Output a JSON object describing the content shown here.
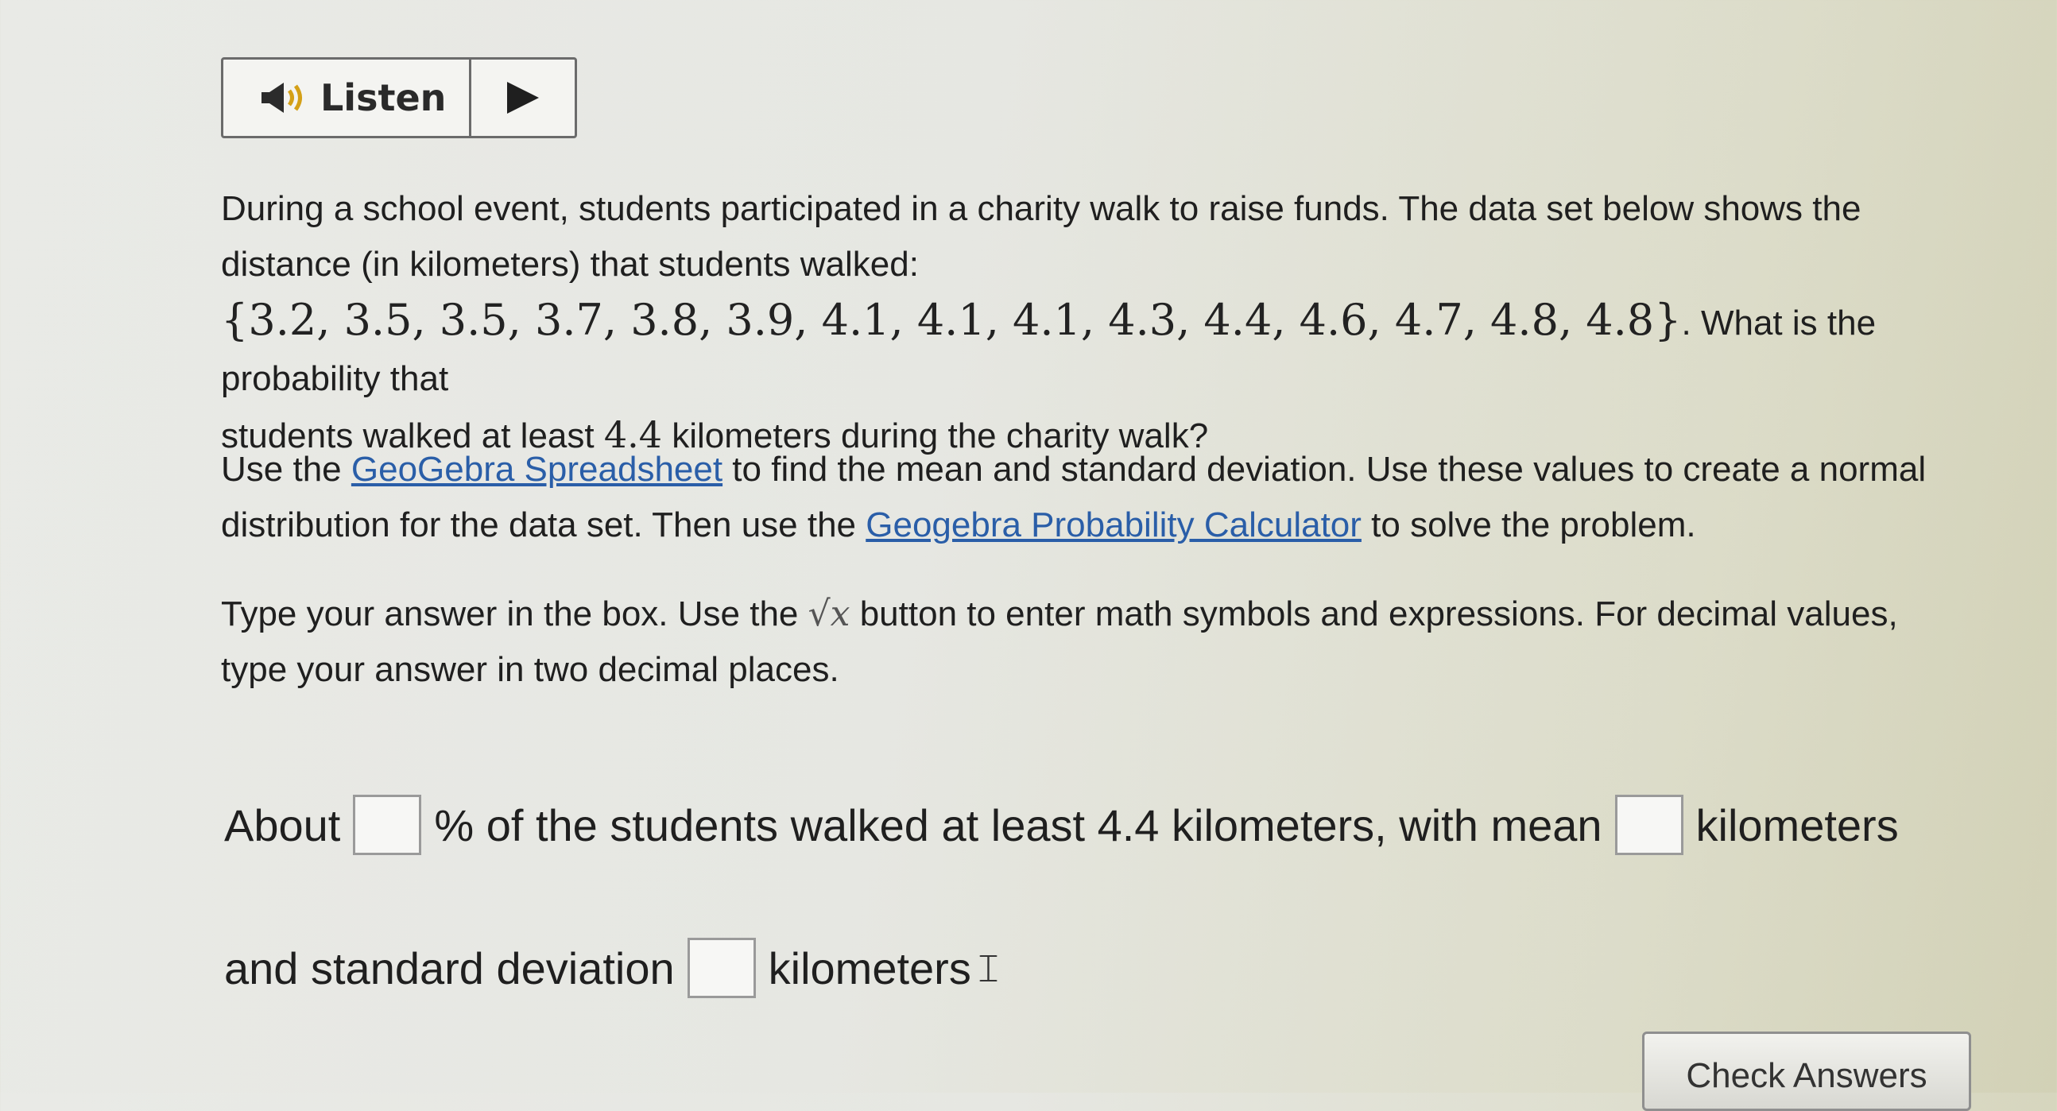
{
  "listen": {
    "label": "Listen",
    "speaker_icon": "speaker-icon",
    "play_icon": "play-icon"
  },
  "question": {
    "line1": "During a school event, students participated in a charity walk to raise funds. The data set below shows the",
    "line2": "distance (in kilometers) that students walked:",
    "dataset": "{3.2, 3.5, 3.5, 3.7, 3.8, 3.9, 4.1, 4.1, 4.1, 4.3, 4.4, 4.6, 4.7, 4.8, 4.8}",
    "line3_after": ". What is the probability that",
    "line4_before": "students walked at least ",
    "threshold": "4.4",
    "line4_after": " kilometers during the charity walk?"
  },
  "instructions": {
    "p1_before": "Use the ",
    "link1": "GeoGebra Spreadsheet",
    "p1_middle": " to find the mean and standard deviation. Use these values to create a normal distribution for the data set. Then use the ",
    "link2": "Geogebra Probability Calculator",
    "p1_after": " to solve the problem.",
    "p2_before": "Type your answer in the box. Use the ",
    "sqrt_symbol": "√x",
    "p2_after": " button to enter math symbols and expressions. For decimal values, type your answer in two decimal places."
  },
  "answer": {
    "about": "About",
    "percent_text": "% of the students walked at least 4.4 kilometers, with mean",
    "kilometers_1": "kilometers",
    "and_sd": "and standard deviation",
    "kilometers_2": "kilometers",
    "percent_value": "",
    "mean_value": "",
    "sd_value": ""
  },
  "check_button": {
    "label": "Check Answers"
  }
}
